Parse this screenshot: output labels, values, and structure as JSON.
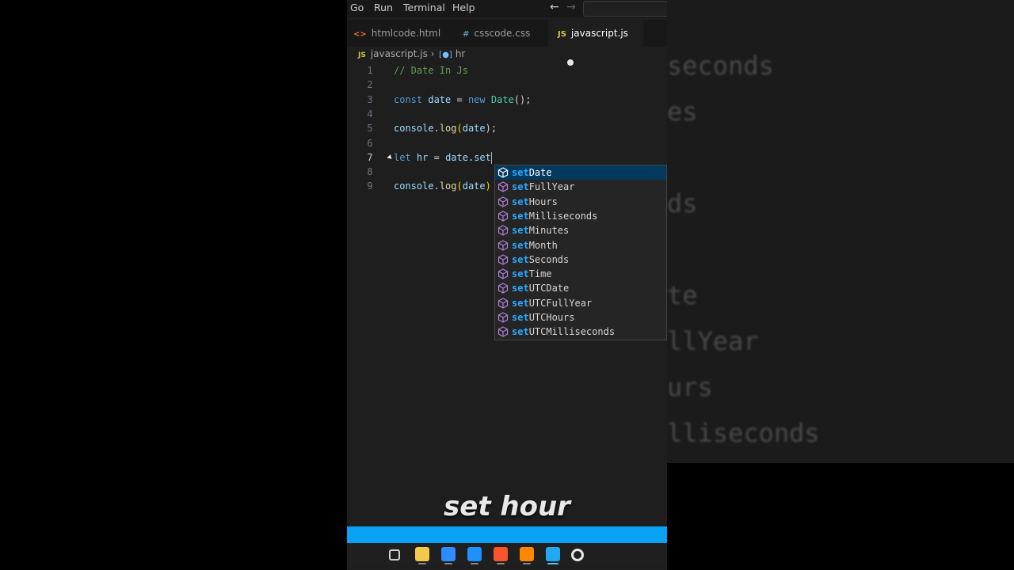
{
  "menu": {
    "items": [
      "Go",
      "Run",
      "Terminal",
      "Help"
    ]
  },
  "tabs": [
    {
      "label": "htmlcode.html",
      "icon": "<>",
      "color": "#e37933"
    },
    {
      "label": "csscode.css",
      "icon": "#",
      "color": "#519aba"
    },
    {
      "label": "javascript.js",
      "icon": "JS",
      "color": "#cbcb41",
      "active": true,
      "unsaved": true
    }
  ],
  "breadcrumb": {
    "file": "javascript.js",
    "file_icon": "JS",
    "symbol": "hr"
  },
  "editor": {
    "lines": [
      {
        "n": "1",
        "tokens": [
          {
            "t": "// Date In Js",
            "c": "c"
          }
        ]
      },
      {
        "n": "2",
        "tokens": []
      },
      {
        "n": "3",
        "tokens": [
          {
            "t": "const",
            "c": "k"
          },
          {
            "t": " ",
            "c": "p"
          },
          {
            "t": "date",
            "c": "v"
          },
          {
            "t": " = ",
            "c": "p"
          },
          {
            "t": "new",
            "c": "k"
          },
          {
            "t": " ",
            "c": "p"
          },
          {
            "t": "Date",
            "c": "cl"
          },
          {
            "t": "();",
            "c": "p"
          }
        ]
      },
      {
        "n": "4",
        "tokens": []
      },
      {
        "n": "5",
        "tokens": [
          {
            "t": "console",
            "c": "v"
          },
          {
            "t": ".",
            "c": "p"
          },
          {
            "t": "log",
            "c": "f"
          },
          {
            "t": "(",
            "c": "y"
          },
          {
            "t": "date",
            "c": "v"
          },
          {
            "t": ");",
            "c": "p"
          }
        ]
      },
      {
        "n": "6",
        "tokens": []
      },
      {
        "n": "7",
        "current": true,
        "tokens": [
          {
            "t": "let",
            "c": "k"
          },
          {
            "t": " ",
            "c": "p"
          },
          {
            "t": "hr",
            "c": "v"
          },
          {
            "t": " = ",
            "c": "p"
          },
          {
            "t": "date",
            "c": "v"
          },
          {
            "t": ".",
            "c": "p"
          },
          {
            "t": "set",
            "c": "v"
          }
        ]
      },
      {
        "n": "8",
        "tokens": []
      },
      {
        "n": "9",
        "tokens": [
          {
            "t": "console",
            "c": "v"
          },
          {
            "t": ".",
            "c": "p"
          },
          {
            "t": "log",
            "c": "f"
          },
          {
            "t": "(",
            "c": "y"
          },
          {
            "t": "date",
            "c": "v"
          },
          {
            "t": ")",
            "c": "y"
          }
        ]
      }
    ]
  },
  "suggestions": {
    "prefix": "set",
    "items": [
      "setDate",
      "setFullYear",
      "setHours",
      "setMilliseconds",
      "setMinutes",
      "setMonth",
      "setSeconds",
      "setTime",
      "setUTCDate",
      "setUTCFullYear",
      "setUTCHours",
      "setUTCMilliseconds"
    ],
    "selected_index": 0
  },
  "background_words": [
    "seconds",
    "es",
    "ds",
    "te",
    "llYear",
    "urs",
    "lliseconds"
  ],
  "caption": "set hour",
  "colors": {
    "statusbar": "#0aa2f5",
    "selection": "#04395e",
    "method_icon": "#b180d7"
  },
  "taskbar": {
    "icons": [
      "task-view-icon",
      "file-explorer-icon",
      "store-icon",
      "mail-icon",
      "brave-browser-icon",
      "vlc-icon",
      "vscode-icon",
      "chrome-icon"
    ]
  }
}
